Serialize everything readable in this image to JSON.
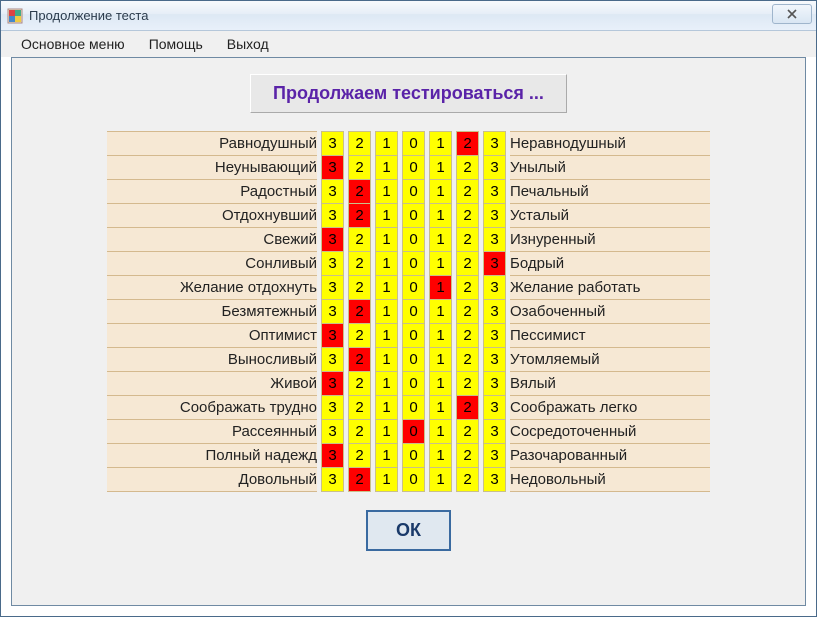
{
  "window": {
    "title": "Продолжение теста"
  },
  "menu": {
    "main": "Основное меню",
    "help": "Помощь",
    "exit": "Выход"
  },
  "heading": "Продолжаем тестироваться ...",
  "scale_labels": [
    "3",
    "2",
    "1",
    "0",
    "1",
    "2",
    "3"
  ],
  "rows": [
    {
      "left": "Равнодушный",
      "sel": 5,
      "right": "Неравнодушный"
    },
    {
      "left": "Неунывающий",
      "sel": 0,
      "right": "Унылый"
    },
    {
      "left": "Радостный",
      "sel": 1,
      "right": "Печальный"
    },
    {
      "left": "Отдохнувший",
      "sel": 1,
      "right": "Усталый"
    },
    {
      "left": "Свежий",
      "sel": 0,
      "right": "Изнуренный"
    },
    {
      "left": "Сонливый",
      "sel": 6,
      "right": "Бодрый"
    },
    {
      "left": "Желание отдохнуть",
      "sel": 4,
      "right": "Желание работать"
    },
    {
      "left": "Безмятежный",
      "sel": 1,
      "right": "Озабоченный"
    },
    {
      "left": "Оптимист",
      "sel": 0,
      "right": "Пессимист"
    },
    {
      "left": "Выносливый",
      "sel": 1,
      "right": "Утомляемый"
    },
    {
      "left": "Живой",
      "sel": 0,
      "right": "Вялый"
    },
    {
      "left": "Соображать трудно",
      "sel": 5,
      "right": "Соображать легко"
    },
    {
      "left": "Рассеянный",
      "sel": 3,
      "right": "Сосредоточенный"
    },
    {
      "left": "Полный надежд",
      "sel": 0,
      "right": "Разочарованный"
    },
    {
      "left": "Довольный",
      "sel": 1,
      "right": "Недовольный"
    }
  ],
  "ok_label": "ОК"
}
